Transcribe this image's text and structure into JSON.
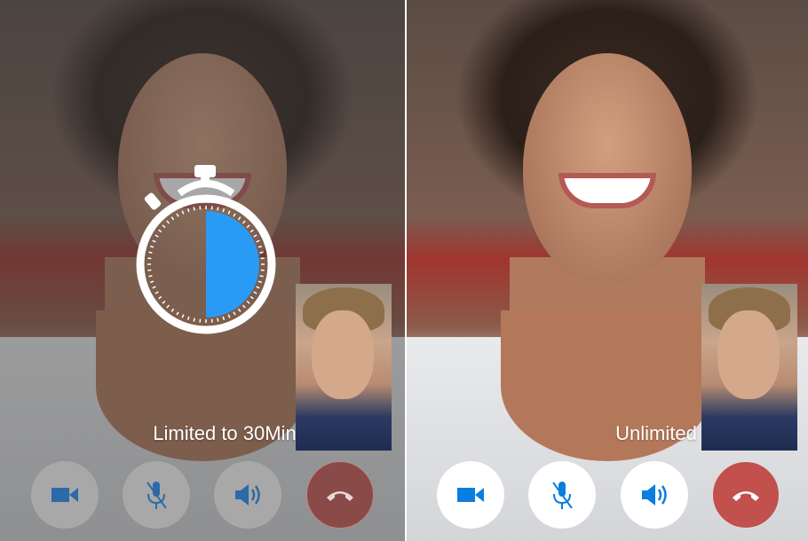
{
  "panels": [
    {
      "caption": "Limited to 30Min",
      "state": "free",
      "timer": {
        "progress": 0.5,
        "color": "#2a9bf5"
      }
    },
    {
      "caption": "Unlimited",
      "state": "premium"
    }
  ],
  "controls": [
    {
      "name": "video-camera",
      "icon": "video-icon"
    },
    {
      "name": "mute-microphone",
      "icon": "mic-off-icon"
    },
    {
      "name": "speaker",
      "icon": "speaker-icon"
    },
    {
      "name": "end-call",
      "icon": "phone-hangup-icon"
    }
  ],
  "colors": {
    "accent": "#0a7de0",
    "dimAccent": "#2a6aa8",
    "endCall": "#c2504d",
    "timer": "#2a9bf5"
  }
}
